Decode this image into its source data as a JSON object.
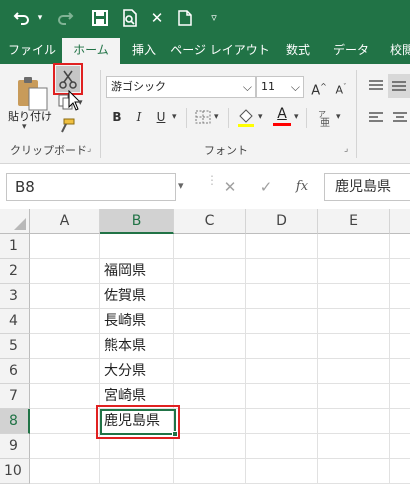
{
  "quick_access": {
    "undo_icon": "undo-icon",
    "redo_icon": "redo-icon",
    "save_icon": "save-icon",
    "print_preview_icon": "print-preview-icon",
    "close_glyph": "✕",
    "new_icon": "new-document-icon",
    "customize_icon": "chevron-down-icon"
  },
  "tabs": [
    "ファイル",
    "ホーム",
    "挿入",
    "ページ レイアウト",
    "数式",
    "データ",
    "校閲"
  ],
  "active_tab": "ホーム",
  "ribbon": {
    "clipboard": {
      "paste_label": "貼り付け",
      "group_label": "クリップボード"
    },
    "font": {
      "font_name": "游ゴシック",
      "font_size": "11",
      "grow_label": "A",
      "shrink_label": "A",
      "bold": "B",
      "italic": "I",
      "underline": "U",
      "font_color_label": "A",
      "group_label": "フォント"
    }
  },
  "formula_bar": {
    "name_box": "B8",
    "fx_label": "fx",
    "value": "鹿児島県"
  },
  "sheet": {
    "columns": [
      "A",
      "B",
      "C",
      "D",
      "E"
    ],
    "rows": [
      "1",
      "2",
      "3",
      "4",
      "5",
      "6",
      "7",
      "8",
      "9",
      "10"
    ],
    "selected_cell": "B8",
    "column_b": [
      "",
      "福岡県",
      "佐賀県",
      "長崎県",
      "熊本県",
      "大分県",
      "宮崎県",
      "鹿児島県",
      "",
      ""
    ]
  },
  "colors": {
    "accent": "#217346",
    "highlight": "#e02020",
    "font_color_bar": "#ff0000"
  }
}
